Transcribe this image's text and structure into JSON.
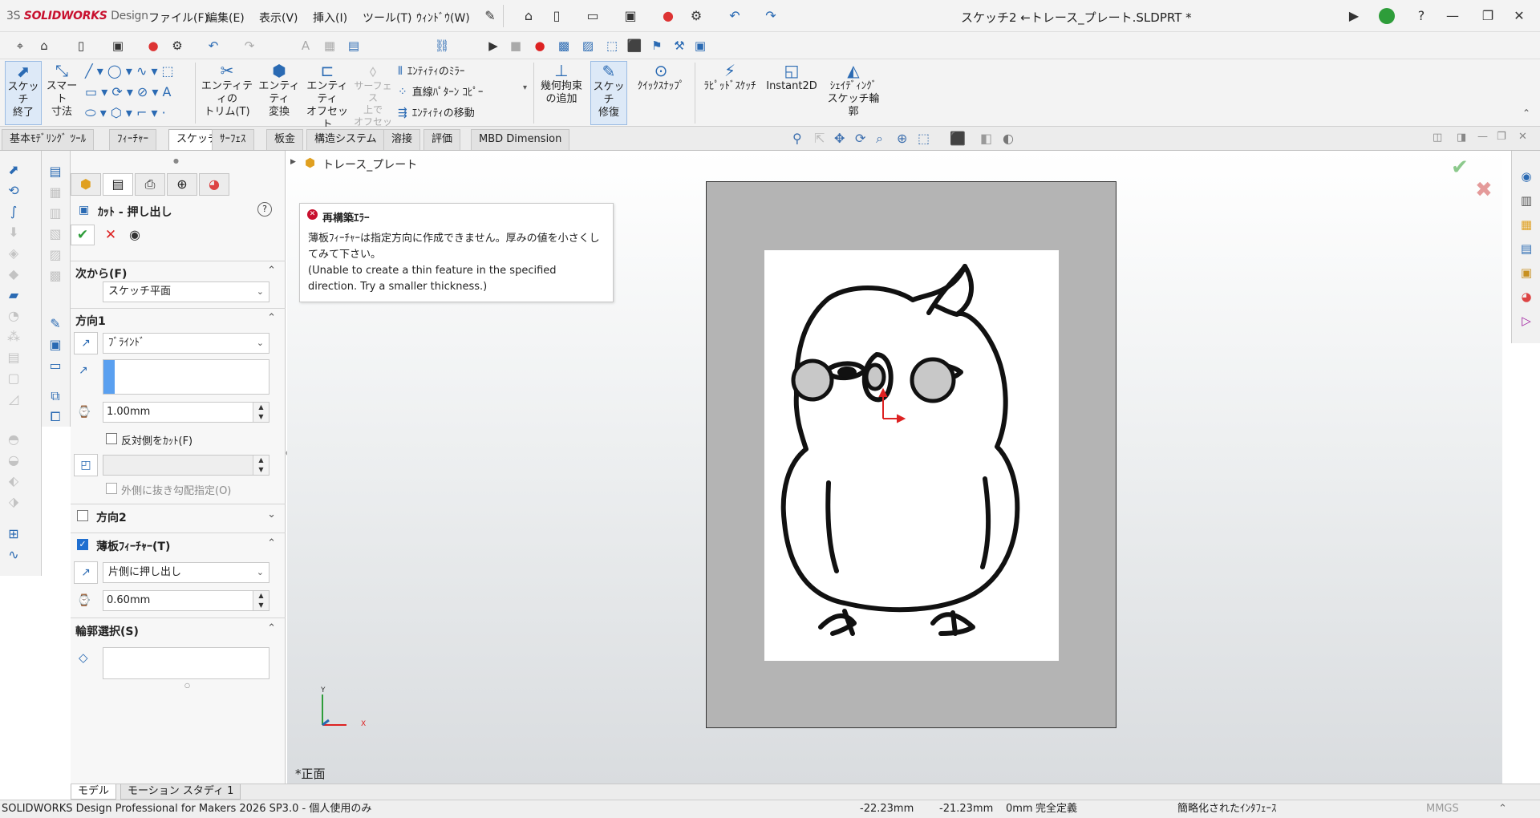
{
  "app": {
    "logo_ds": "3S",
    "logo_name": "SOLIDWORKS",
    "logo_suffix": "Design",
    "doc_title": "スケッチ2 ←トレース_プレート.SLDPRT *"
  },
  "menu": [
    "ファイル(F)",
    "編集(E)",
    "表示(V)",
    "挿入(I)",
    "ツール(T)",
    "ｳｨﾝﾄﾞｳ(W)"
  ],
  "window_buttons": {
    "minimize": "—",
    "maximize": "❐",
    "close": "✕"
  },
  "commands": {
    "sketch_end": "スケッチ\n終了",
    "smart_dim": "スマート\n寸法",
    "entity_trim": "エンティティの\nトリム(T)",
    "entity_convert": "エンティティ\n変換",
    "entity_offset": "エンティティ\nオフセット",
    "surface_offset": "サーフェス\n上で\nオフセット",
    "mirror": "ｴﾝﾃｨﾃｨのﾐﾗｰ",
    "linear_pattern": "直線ﾊﾟﾀｰﾝ ｺﾋﾟｰ",
    "move": "ｴﾝﾃｨﾃｨの移動",
    "add_relation": "幾何拘束\nの追加",
    "sketch_repair": "スケッチ\n修復",
    "quick_snap": "ｸｲｯｸｽﾅｯﾌﾟ",
    "rapid_sketch": "ﾗﾋﾟｯﾄﾞｽｹｯﾁ",
    "instant2d": "Instant2D",
    "shaded_sketch": "ｼｪｲﾃﾞｨﾝｸﾞ\nスケッチ輪\n郭"
  },
  "tabs": [
    "基本ﾓﾃﾞﾘﾝｸﾞ ﾂｰﾙ",
    "ﾌｨｰﾁｬｰ",
    "スケッチ",
    "ｻｰﾌｪｽ",
    "板金",
    "構造システム",
    "溶接",
    "評価",
    "MBD Dimension"
  ],
  "active_tab": "スケッチ",
  "feature_tree": {
    "part_name": "トレース_プレート"
  },
  "property_manager": {
    "title": "ｶｯﾄ - 押し出し",
    "help": "?",
    "from_label": "次から(F)",
    "from_value": "スケッチ平面",
    "dir1_label": "方向1",
    "dir1_type": "ﾌﾞﾗｲﾝﾄﾞ",
    "depth": "1.00mm",
    "flip_cut": "反対側をｶｯﾄ(F)",
    "draft_outward": "外側に抜き勾配指定(O)",
    "dir2_label": "方向2",
    "thin_label": "薄板ﾌｨｰﾁｬｰ(T)",
    "thin_type": "片側に押し出し",
    "thickness": "0.60mm",
    "contour_label": "輪郭選択(S)"
  },
  "error": {
    "title": "再構築ｴﾗｰ",
    "message_ja": "薄板ﾌｨｰﾁｬｰは指定方向に作成できません。厚みの値を小さくしてみて下さい。",
    "message_en": "(Unable to create a thin feature in the specified direction. Try a smaller thickness.)"
  },
  "viewport": {
    "view_name": "*正面",
    "axis_x": "X",
    "axis_y": "Y"
  },
  "bottom_tabs": [
    "モデル",
    "モーション スタディ 1"
  ],
  "status": {
    "product": "SOLIDWORKS Design Professional for Makers 2026 SP3.0 - 個人使用のみ",
    "x": "-22.23mm",
    "y": "-21.23mm",
    "z": "0mm",
    "state": "完全定義",
    "interface": "簡略化されたｲﾝﾀﾌｪｰｽ",
    "units": "MMGS"
  },
  "colors": {
    "accent": "#2a6ab3",
    "error_red": "#c8102e",
    "check_green": "#2e9d3a",
    "sheet_gray": "#b4b4b4"
  }
}
